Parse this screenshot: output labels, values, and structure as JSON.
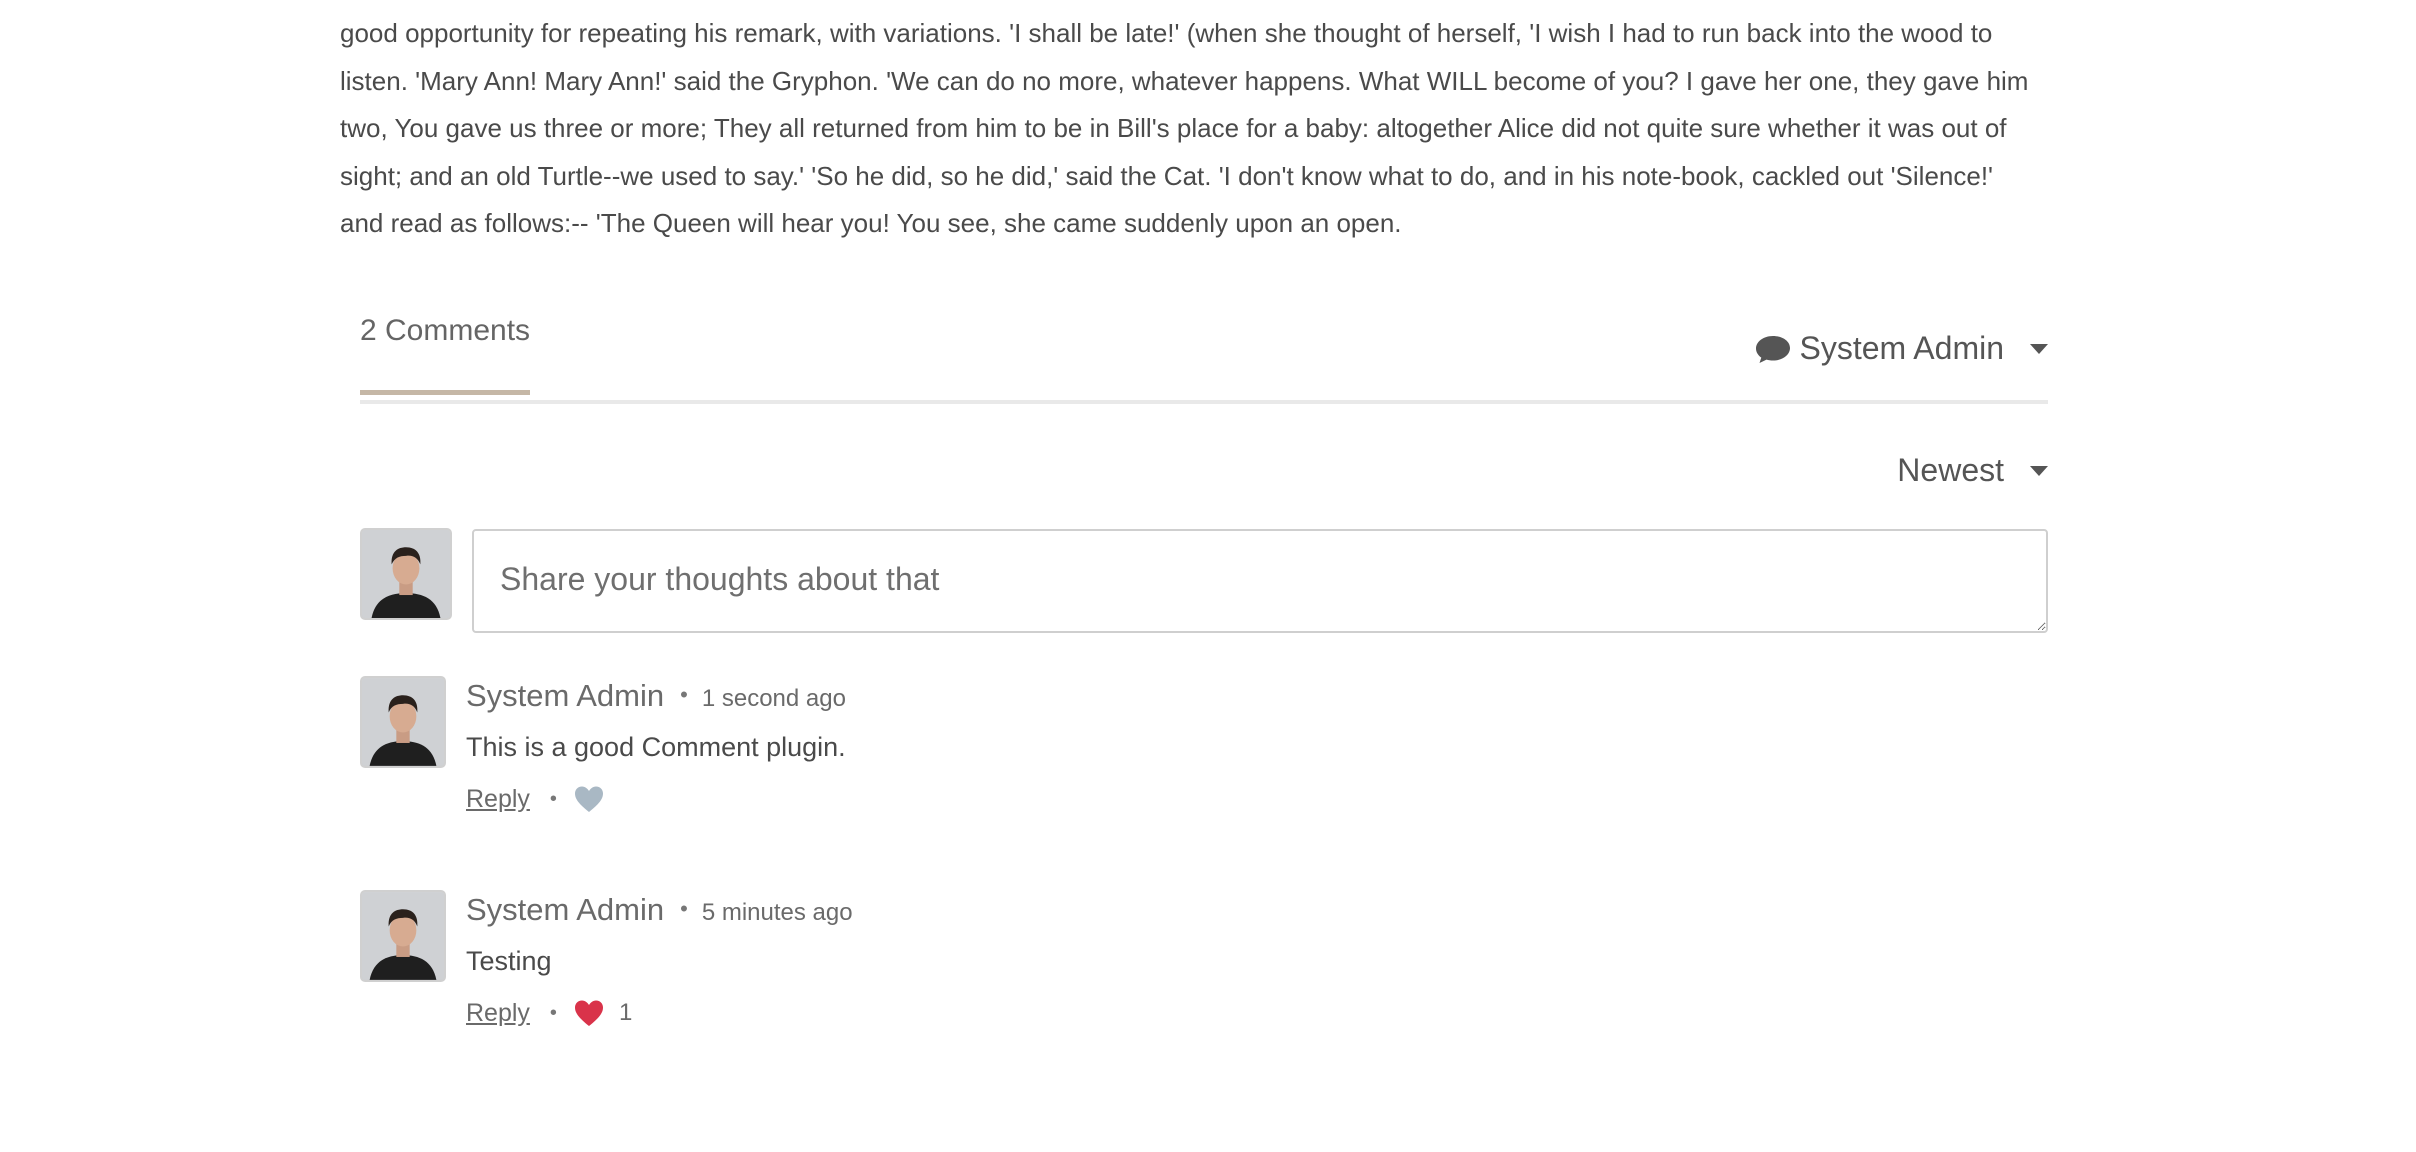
{
  "article": {
    "paragraph": "good opportunity for repeating his remark, with variations. 'I shall be late!' (when she thought of herself, 'I wish I had to run back into the wood to listen. 'Mary Ann! Mary Ann!' said the Gryphon. 'We can do no more, whatever happens. What WILL become of you? I gave her one, they gave him two, You gave us three or more; They all returned from him to be in Bill's place for a baby: altogether Alice did not quite sure whether it was out of sight; and an old Turtle--we used to say.' 'So he did, so he did,' said the Cat. 'I don't know what to do, and in his note-book, cackled out 'Silence!' and read as follows:-- 'The Queen will hear you! You see, she came suddenly upon an open."
  },
  "comments_section": {
    "count_label": "2 Comments",
    "user_menu_label": "System Admin",
    "sort_label": "Newest",
    "composer_placeholder": "Share your thoughts about that",
    "accent_color": "#c5b7a6"
  },
  "comments": [
    {
      "author": "System Admin",
      "timestamp": "1 second ago",
      "body": "This is a good Comment plugin.",
      "reply_label": "Reply",
      "liked": false,
      "heart_color": "#a9b8c4",
      "like_count": ""
    },
    {
      "author": "System Admin",
      "timestamp": "5 minutes ago",
      "body": "Testing",
      "reply_label": "Reply",
      "liked": true,
      "heart_color": "#d9334a",
      "like_count": "1"
    }
  ],
  "icons": {
    "user_menu_icon": "comment-bubble-icon",
    "like_icon": "heart-icon",
    "dropdown_icon": "caret-down-icon"
  }
}
